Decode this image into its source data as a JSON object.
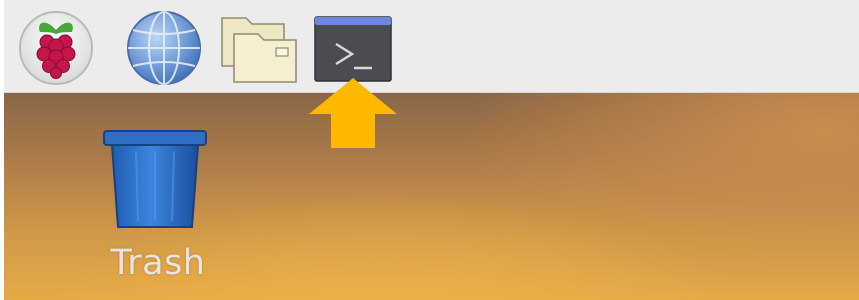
{
  "taskbar": {
    "launchers": [
      {
        "name": "raspberry-pi-menu",
        "icon": "raspberry-icon"
      },
      {
        "name": "web-browser",
        "icon": "globe-icon"
      },
      {
        "name": "file-manager",
        "icon": "folder-icon"
      },
      {
        "name": "terminal",
        "icon": "terminal-icon"
      }
    ]
  },
  "desktop": {
    "icons": [
      {
        "label": "Trash",
        "icon": "trash-bin-icon"
      }
    ]
  },
  "annotation": {
    "icon": "arrow-up-icon",
    "color": "#ffb800"
  },
  "colors": {
    "taskbar_bg": "#ececec",
    "trash_blue": "#2b6fc6",
    "arrow_yellow": "#ffb800",
    "desktop_label": "#e9e4dd"
  }
}
